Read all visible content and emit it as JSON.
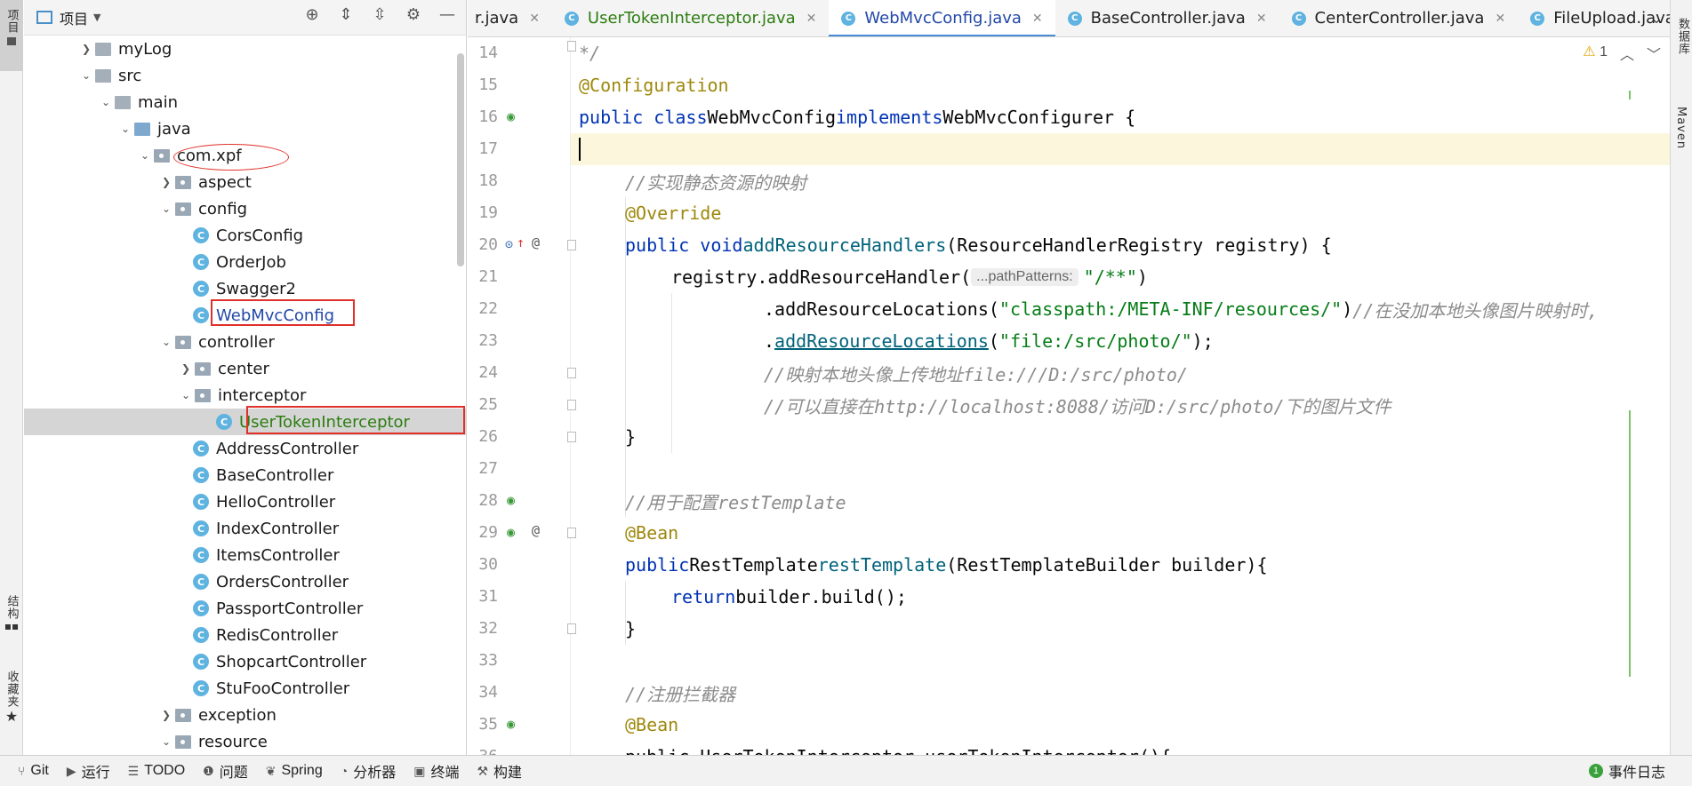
{
  "left_strip": {
    "project_label": "项目",
    "structure_label": "结构",
    "favorites_label": "收藏夹"
  },
  "right_strip": {
    "database_label": "数据库",
    "maven_label": "Maven"
  },
  "project_panel": {
    "title": "项目",
    "tree": [
      {
        "label": "myLog",
        "type": "folder"
      },
      {
        "label": "src",
        "type": "folder"
      },
      {
        "label": "main",
        "type": "folder"
      },
      {
        "label": "java",
        "type": "folder"
      },
      {
        "label": "com.xpf",
        "type": "package"
      },
      {
        "label": "aspect",
        "type": "package"
      },
      {
        "label": "config",
        "type": "package"
      },
      {
        "label": "CorsConfig",
        "type": "class"
      },
      {
        "label": "OrderJob",
        "type": "class"
      },
      {
        "label": "Swagger2",
        "type": "class"
      },
      {
        "label": "WebMvcConfig",
        "type": "class"
      },
      {
        "label": "controller",
        "type": "package"
      },
      {
        "label": "center",
        "type": "package"
      },
      {
        "label": "interceptor",
        "type": "package"
      },
      {
        "label": "UserTokenInterceptor",
        "type": "class"
      },
      {
        "label": "AddressController",
        "type": "class"
      },
      {
        "label": "BaseController",
        "type": "class"
      },
      {
        "label": "HelloController",
        "type": "class"
      },
      {
        "label": "IndexController",
        "type": "class"
      },
      {
        "label": "ItemsController",
        "type": "class"
      },
      {
        "label": "OrdersController",
        "type": "class"
      },
      {
        "label": "PassportController",
        "type": "class"
      },
      {
        "label": "RedisController",
        "type": "class"
      },
      {
        "label": "ShopcartController",
        "type": "class"
      },
      {
        "label": "StuFooController",
        "type": "class"
      },
      {
        "label": "exception",
        "type": "package"
      },
      {
        "label": "resource",
        "type": "package"
      }
    ]
  },
  "tabs": [
    {
      "label": "r.java"
    },
    {
      "label": "UserTokenInterceptor.java"
    },
    {
      "label": "WebMvcConfig.java"
    },
    {
      "label": "BaseController.java"
    },
    {
      "label": "CenterController.java"
    },
    {
      "label": "FileUpload.java"
    }
  ],
  "editor": {
    "warning_count": "1",
    "line_numbers": [
      "14",
      "15",
      "16",
      "17",
      "18",
      "19",
      "20",
      "21",
      "22",
      "23",
      "24",
      "25",
      "26",
      "27",
      "28",
      "29",
      "30",
      "31",
      "32",
      "33",
      "34",
      "35",
      "36"
    ],
    "code": {
      "l14": "*/",
      "l15": "@Configuration",
      "l16_kw": "public class",
      "l16_name": "WebMvcConfig",
      "l16_impl": "implements",
      "l16_rest": "WebMvcConfigurer {",
      "l18": "//实现静态资源的映射",
      "l19": "@Override",
      "l20_kw": "public void",
      "l20_fn": "addResourceHandlers",
      "l20_rest": "(ResourceHandlerRegistry registry) {",
      "l21_pre": "registry.addResourceHandler(",
      "l21_hint": "...pathPatterns:",
      "l21_str": "\"/**\"",
      "l21_post": ")",
      "l22_pre": ".addResourceLocations(",
      "l22_str": "\"classpath:/META-INF/resources/\"",
      "l22_post": ")",
      "l22_cm": "//在没加本地头像图片映射时,",
      "l23_pre": ".",
      "l23_fn": "addResourceLocations",
      "l23_str": "\"file:/src/photo/\"",
      "l23_post": ");",
      "l24": "//映射本地头像上传地址file:///D:/src/photo/",
      "l25": "//可以直接在http://localhost:8088/访问D:/src/photo/下的图片文件",
      "l26": "}",
      "l28": "//用于配置restTemplate",
      "l29": "@Bean",
      "l30_kw": "public",
      "l30_type": "RestTemplate",
      "l30_fn": "restTemplate",
      "l30_rest": "(RestTemplateBuilder builder){",
      "l31_kw": "return",
      "l31_rest": "builder.build();",
      "l32": "}",
      "l34": "//注册拦截器",
      "l35": "@Bean",
      "l36": "public UserTokenInterceptor userTokenInterceptor(){"
    }
  },
  "statusbar": {
    "items": [
      "Git",
      "运行",
      "TODO",
      "问题",
      "Spring",
      "分析器",
      "终端",
      "构建"
    ],
    "event_log": "事件日志",
    "event_count": "1"
  },
  "colors": {
    "highlight_red": "#e0302a",
    "active_tab_underline": "#4a8ad4",
    "class_icon": "#5fb3e0"
  }
}
